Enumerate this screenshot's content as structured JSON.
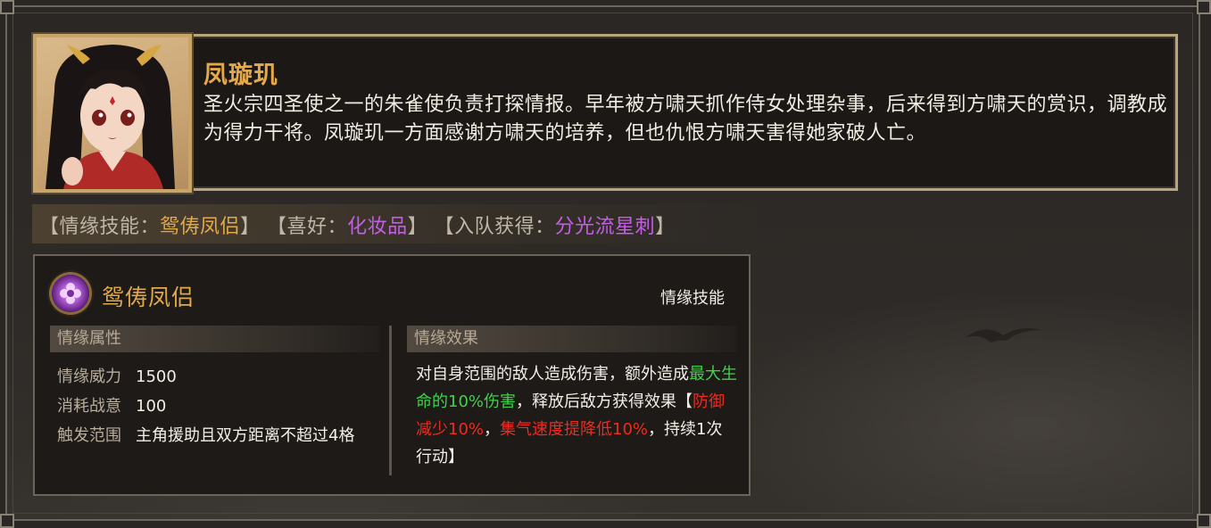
{
  "character": {
    "name": "凤璇玑",
    "bio": "圣火宗四圣使之一的朱雀使负责打探情报。早年被方啸天抓作侍女处理杂事，后来得到方啸天的赏识，调教成为得力干将。凤璇玑一方面感谢方啸天的培养，但也仇恨方啸天害得她家破人亡。"
  },
  "info": {
    "bond_skill_label": "【情缘技能：",
    "bond_skill_value": "鸳俦凤侣",
    "bond_skill_close": "】",
    "hobby_label": "【喜好：",
    "hobby_value": "化妆品",
    "hobby_close": "】",
    "join_label": "【入队获得：",
    "join_value": "分光流星刺",
    "join_close": "】"
  },
  "skill": {
    "icon": "purple-flower-orb-icon",
    "name": "鸳俦凤侣",
    "type": "情缘技能",
    "attributes_header": "情缘属性",
    "attributes": [
      {
        "label": "情缘威力",
        "value": "1500"
      },
      {
        "label": "消耗战意",
        "value": "100"
      },
      {
        "label": "触发范围",
        "value": "主角援助且双方距离不超过4格"
      }
    ],
    "effect_header": "情缘效果",
    "effect": {
      "part1": "对自身范围的敌人造成伤害，额外造成",
      "highlight_green": "最大生命的10%伤害",
      "part2": "，释放后敌方获得效果【",
      "highlight_red1": "防御减少10%",
      "sep": "，",
      "highlight_red2": "集气速度提降低10%",
      "part3": "，持续1次行动】"
    }
  },
  "colors": {
    "name_gold": "#e4a94a",
    "value_purple": "#c45ee6",
    "effect_green": "#3fd24a",
    "effect_red": "#ef2a1f"
  }
}
